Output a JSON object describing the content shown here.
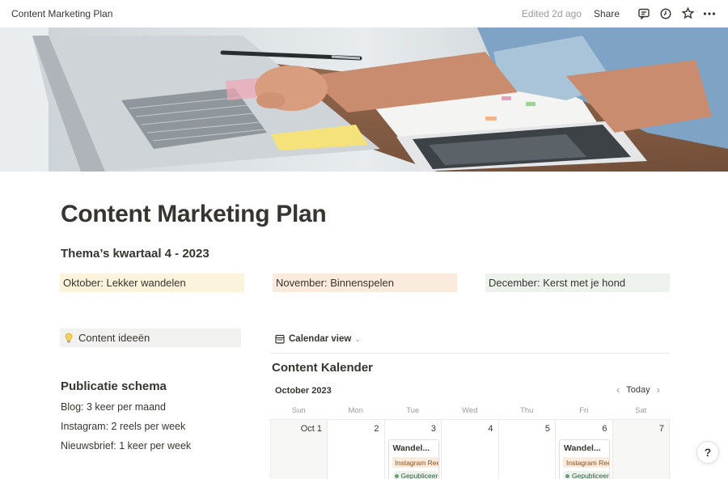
{
  "topbar": {
    "title": "Content Marketing Plan",
    "edited": "Edited 2d ago",
    "share": "Share"
  },
  "page": {
    "title": "Content Marketing Plan",
    "themes_heading": "Thema’s kwartaal 4 - 2023",
    "themes": [
      {
        "label": "Oktober: Lekker wandelen",
        "color": "#fbf3db"
      },
      {
        "label": "November: Binnenspelen",
        "color": "#faebdd"
      },
      {
        "label": "December: Kerst met je hond",
        "color": "#edf3ec"
      }
    ],
    "callout": {
      "icon": "lightbulb-icon",
      "label": "Content ideeën"
    },
    "schedule": {
      "heading": "Publicatie schema",
      "lines": [
        "Blog: 3 keer per maand",
        "Instagram: 2 reels per week",
        "Nieuwsbrief: 1 keer per week"
      ]
    }
  },
  "calendar": {
    "view_label": "Calendar view",
    "title": "Content Kalender",
    "month": "October 2023",
    "today": "Today",
    "weekdays": [
      "Sun",
      "Mon",
      "Tue",
      "Wed",
      "Thu",
      "Fri",
      "Sat"
    ],
    "days": [
      "Oct 1",
      "2",
      "3",
      "4",
      "5",
      "6",
      "7"
    ],
    "cards": [
      {
        "title": "Wandel...",
        "tag": "Instagram Reel",
        "status": "Gepubliceerd"
      },
      {
        "title": "Wandel...",
        "tag": "Instagram Reel",
        "status": "Gepubliceerd"
      }
    ]
  },
  "help": {
    "label": "?"
  }
}
